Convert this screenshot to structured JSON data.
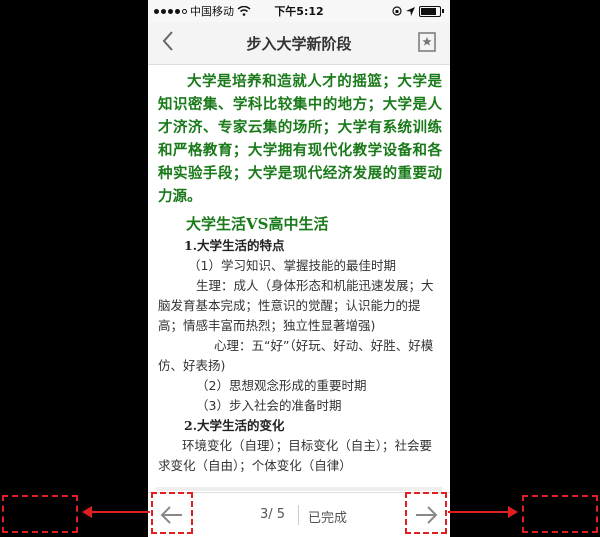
{
  "statusbar": {
    "carrier": "中国移动",
    "time": "下午5:12"
  },
  "navbar": {
    "title": "步入大学新阶段"
  },
  "intro": "大学是培养和造就人才的摇篮；大学是知识密集、学科比较集中的地方；大学是人才济济、专家云集的场所；大学有系统训练和严格教育；大学拥有现代化教学设备和各种实验手段；大学是现代经济发展的重要动力源。",
  "section_title": "大学生活VS高中生活",
  "body": {
    "h1": "1.大学生活的特点",
    "l1": "（1）学习知识、掌握技能的最佳时期",
    "l2": "生理：成人（身体形态和机能迅速发展；大脑发育基本完成；性意识的觉醒；认识能力的提高；情感丰富而热烈；独立性显著增强)",
    "l3": "心理：五“好”（好玩、好动、好胜、好模仿、好表扬)",
    "l4": "（2）思想观念形成的重要时期",
    "l5": "（3）步入社会的准备时期",
    "h2": "2.大学生活的变化",
    "l6": "环境变化（自理）；目标变化（自主）；社会要求变化（自由）；个体变化（自律）"
  },
  "bottombar": {
    "page": "3/ 5",
    "status": "已完成"
  },
  "colors": {
    "accent_green": "#1a7a1a",
    "annotation_red": "#e02020"
  },
  "icons": [
    "back-chevron-icon",
    "bookmark-icon",
    "prev-arrow-icon",
    "next-arrow-icon",
    "wifi-icon",
    "location-icon"
  ]
}
